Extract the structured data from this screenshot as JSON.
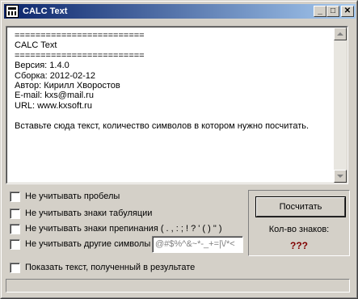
{
  "window": {
    "title": "CALC Text"
  },
  "titlebar_buttons": {
    "minimize": "_",
    "maximize": "□",
    "close": "✕"
  },
  "memo": {
    "text": "=========================\nCALC Text\n=========================\nВерсия: 1.4.0\nСборка: 2012-02-12\nАвтор: Кирилл Хворостов\nE-mail: kxs@mail.ru\nURL: www.kxsoft.ru\n\nВставьте сюда текст, количество символов в котором нужно посчитать."
  },
  "options": {
    "ignore_spaces": {
      "label": "Не учитывать пробелы",
      "checked": false
    },
    "ignore_tabs": {
      "label": "Не учитывать знаки табуляции",
      "checked": false
    },
    "ignore_punct": {
      "label": "Не учитывать знаки препинания ( . , : ; ! ? ' ( ) \" )",
      "checked": false
    },
    "ignore_other": {
      "label": "Не учитывать другие символы",
      "checked": false
    },
    "show_text": {
      "label": "Показать текст, полученный в результате",
      "checked": false
    }
  },
  "other_symbols_input": {
    "value": "@#$%^&~*-_+=|\\/*<"
  },
  "count_button": {
    "label": "Посчитать"
  },
  "result": {
    "label": "Кол-во знаков:",
    "value": "???"
  },
  "progress": {
    "value": 0
  },
  "colors": {
    "title_start": "#0a246a",
    "title_end": "#a6caf0",
    "result_value": "#800000",
    "face": "#d4d0c8"
  }
}
